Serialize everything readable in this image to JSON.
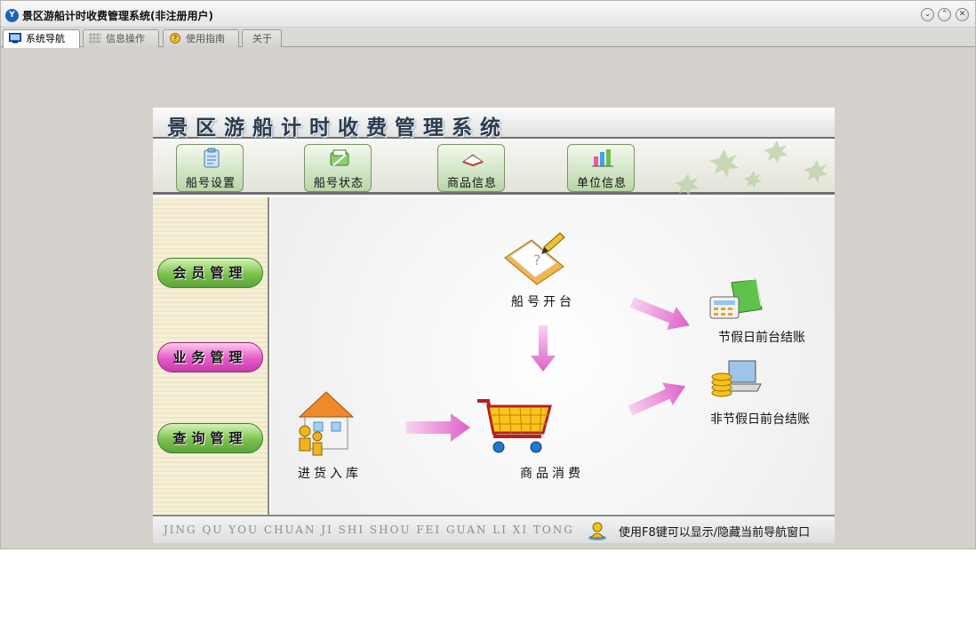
{
  "window": {
    "title": "景区游船计时收费管理系统(非注册用户)",
    "controls": {
      "minimize": "⌄",
      "maximize": "⌃",
      "close": "✕"
    }
  },
  "tabs": [
    {
      "label": "系统导航",
      "icon": "monitor-icon",
      "active": true
    },
    {
      "label": "信息操作",
      "icon": "grid-icon",
      "active": false
    },
    {
      "label": "使用指南",
      "icon": "help-icon",
      "active": false
    },
    {
      "label": "关于",
      "icon": "",
      "active": false
    }
  ],
  "panel": {
    "banner_title": "景区游船计时收费管理系统",
    "toolbar": [
      {
        "label": "船号设置",
        "icon": "boat-settings-icon"
      },
      {
        "label": "船号状态",
        "icon": "boat-status-icon"
      },
      {
        "label": "商品信息",
        "icon": "goods-info-icon"
      },
      {
        "label": "单位信息",
        "icon": "unit-info-icon"
      }
    ],
    "sidebar": [
      {
        "label": "会员管理"
      },
      {
        "label": "业务管理"
      },
      {
        "label": "查询管理"
      }
    ],
    "flow": {
      "open_boat": "船号开台",
      "purchase_stock": "进货入库",
      "consume_goods": "商品消费",
      "holiday_checkout": "节假日前台结账",
      "weekday_checkout": "非节假日前台结账"
    },
    "footer": {
      "pinyin": "JING QU YOU CHUAN JI SHI SHOU FEI GUAN LI XI TONG",
      "tip": "使用F8键可以显示/隐藏当前导航窗口"
    }
  },
  "colors": {
    "window_bg": "#d4d0cb",
    "sidebar_green": "#7cc24d",
    "sidebar_pink": "#e45cc7",
    "arrow_pink": "#e58ad6"
  }
}
